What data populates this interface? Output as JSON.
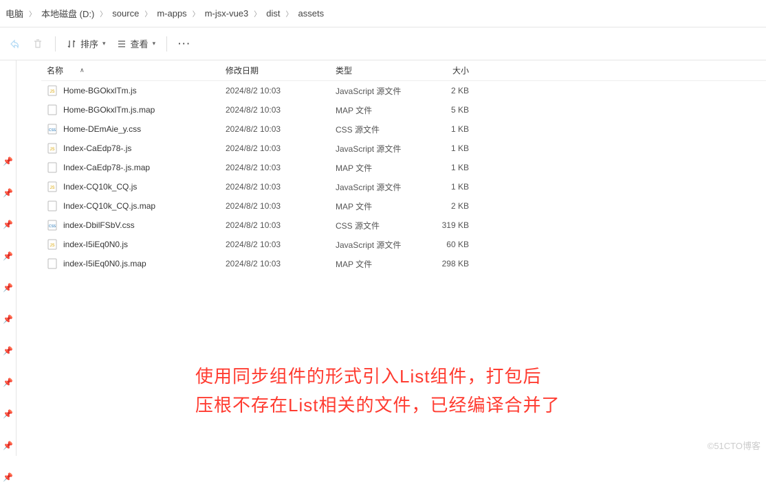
{
  "breadcrumb": [
    {
      "label": "电脑"
    },
    {
      "label": "本地磁盘 (D:)"
    },
    {
      "label": "source"
    },
    {
      "label": "m-apps"
    },
    {
      "label": "m-jsx-vue3"
    },
    {
      "label": "dist"
    },
    {
      "label": "assets"
    }
  ],
  "toolbar": {
    "sort": "排序",
    "view": "查看",
    "more": "···"
  },
  "columns": {
    "name": "名称",
    "date": "修改日期",
    "type": "类型",
    "size": "大小"
  },
  "files": [
    {
      "icon": "js",
      "name": "Home-BGOkxlTm.js",
      "date": "2024/8/2 10:03",
      "type": "JavaScript 源文件",
      "size": "2 KB"
    },
    {
      "icon": "map",
      "name": "Home-BGOkxlTm.js.map",
      "date": "2024/8/2 10:03",
      "type": "MAP 文件",
      "size": "5 KB"
    },
    {
      "icon": "css",
      "name": "Home-DEmAie_y.css",
      "date": "2024/8/2 10:03",
      "type": "CSS 源文件",
      "size": "1 KB"
    },
    {
      "icon": "js",
      "name": "Index-CaEdp78-.js",
      "date": "2024/8/2 10:03",
      "type": "JavaScript 源文件",
      "size": "1 KB"
    },
    {
      "icon": "map",
      "name": "Index-CaEdp78-.js.map",
      "date": "2024/8/2 10:03",
      "type": "MAP 文件",
      "size": "1 KB"
    },
    {
      "icon": "js",
      "name": "Index-CQ10k_CQ.js",
      "date": "2024/8/2 10:03",
      "type": "JavaScript 源文件",
      "size": "1 KB"
    },
    {
      "icon": "map",
      "name": "Index-CQ10k_CQ.js.map",
      "date": "2024/8/2 10:03",
      "type": "MAP 文件",
      "size": "2 KB"
    },
    {
      "icon": "css",
      "name": "index-DbilFSbV.css",
      "date": "2024/8/2 10:03",
      "type": "CSS 源文件",
      "size": "319 KB"
    },
    {
      "icon": "js",
      "name": "index-I5iEq0N0.js",
      "date": "2024/8/2 10:03",
      "type": "JavaScript 源文件",
      "size": "60 KB"
    },
    {
      "icon": "map",
      "name": "index-I5iEq0N0.js.map",
      "date": "2024/8/2 10:03",
      "type": "MAP 文件",
      "size": "298 KB"
    }
  ],
  "annotation": {
    "line1": "使用同步组件的形式引入List组件，打包后",
    "line2": "压根不存在List相关的文件，已经编译合并了"
  },
  "watermark": "©51CTO博客"
}
